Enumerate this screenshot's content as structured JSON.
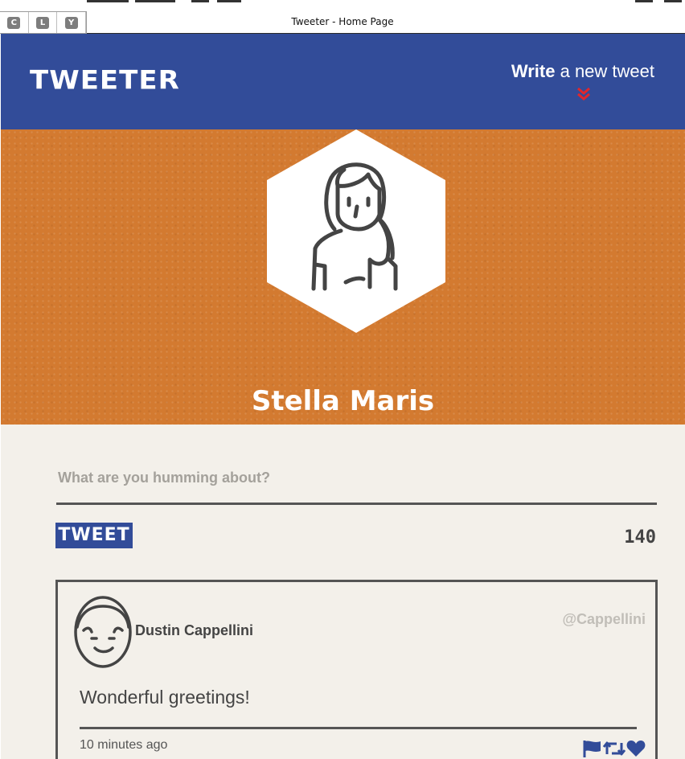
{
  "window": {
    "title": "Tweeter - Home Page",
    "buttons": [
      "C",
      "L",
      "Y"
    ]
  },
  "nav": {
    "logo": "TWEETER",
    "compose_bold": "Write",
    "compose_rest": " a new tweet",
    "accent_color": "#e2262b"
  },
  "profile": {
    "name": "Stella Maris",
    "banner_color": "#d37a30"
  },
  "composer": {
    "placeholder": "What are you humming about?",
    "button_label": "TWEET",
    "char_counter": "140"
  },
  "tweets": [
    {
      "author": "Dustin Cappellini",
      "handle": "@Cappellini",
      "text": "Wonderful greetings!",
      "timestamp": "10 minutes ago",
      "actions": [
        "flag-icon",
        "retweet-icon",
        "heart-icon"
      ]
    }
  ],
  "colors": {
    "brand_blue": "#324c99",
    "background": "#f3f0ea",
    "text_dark": "#444444"
  }
}
